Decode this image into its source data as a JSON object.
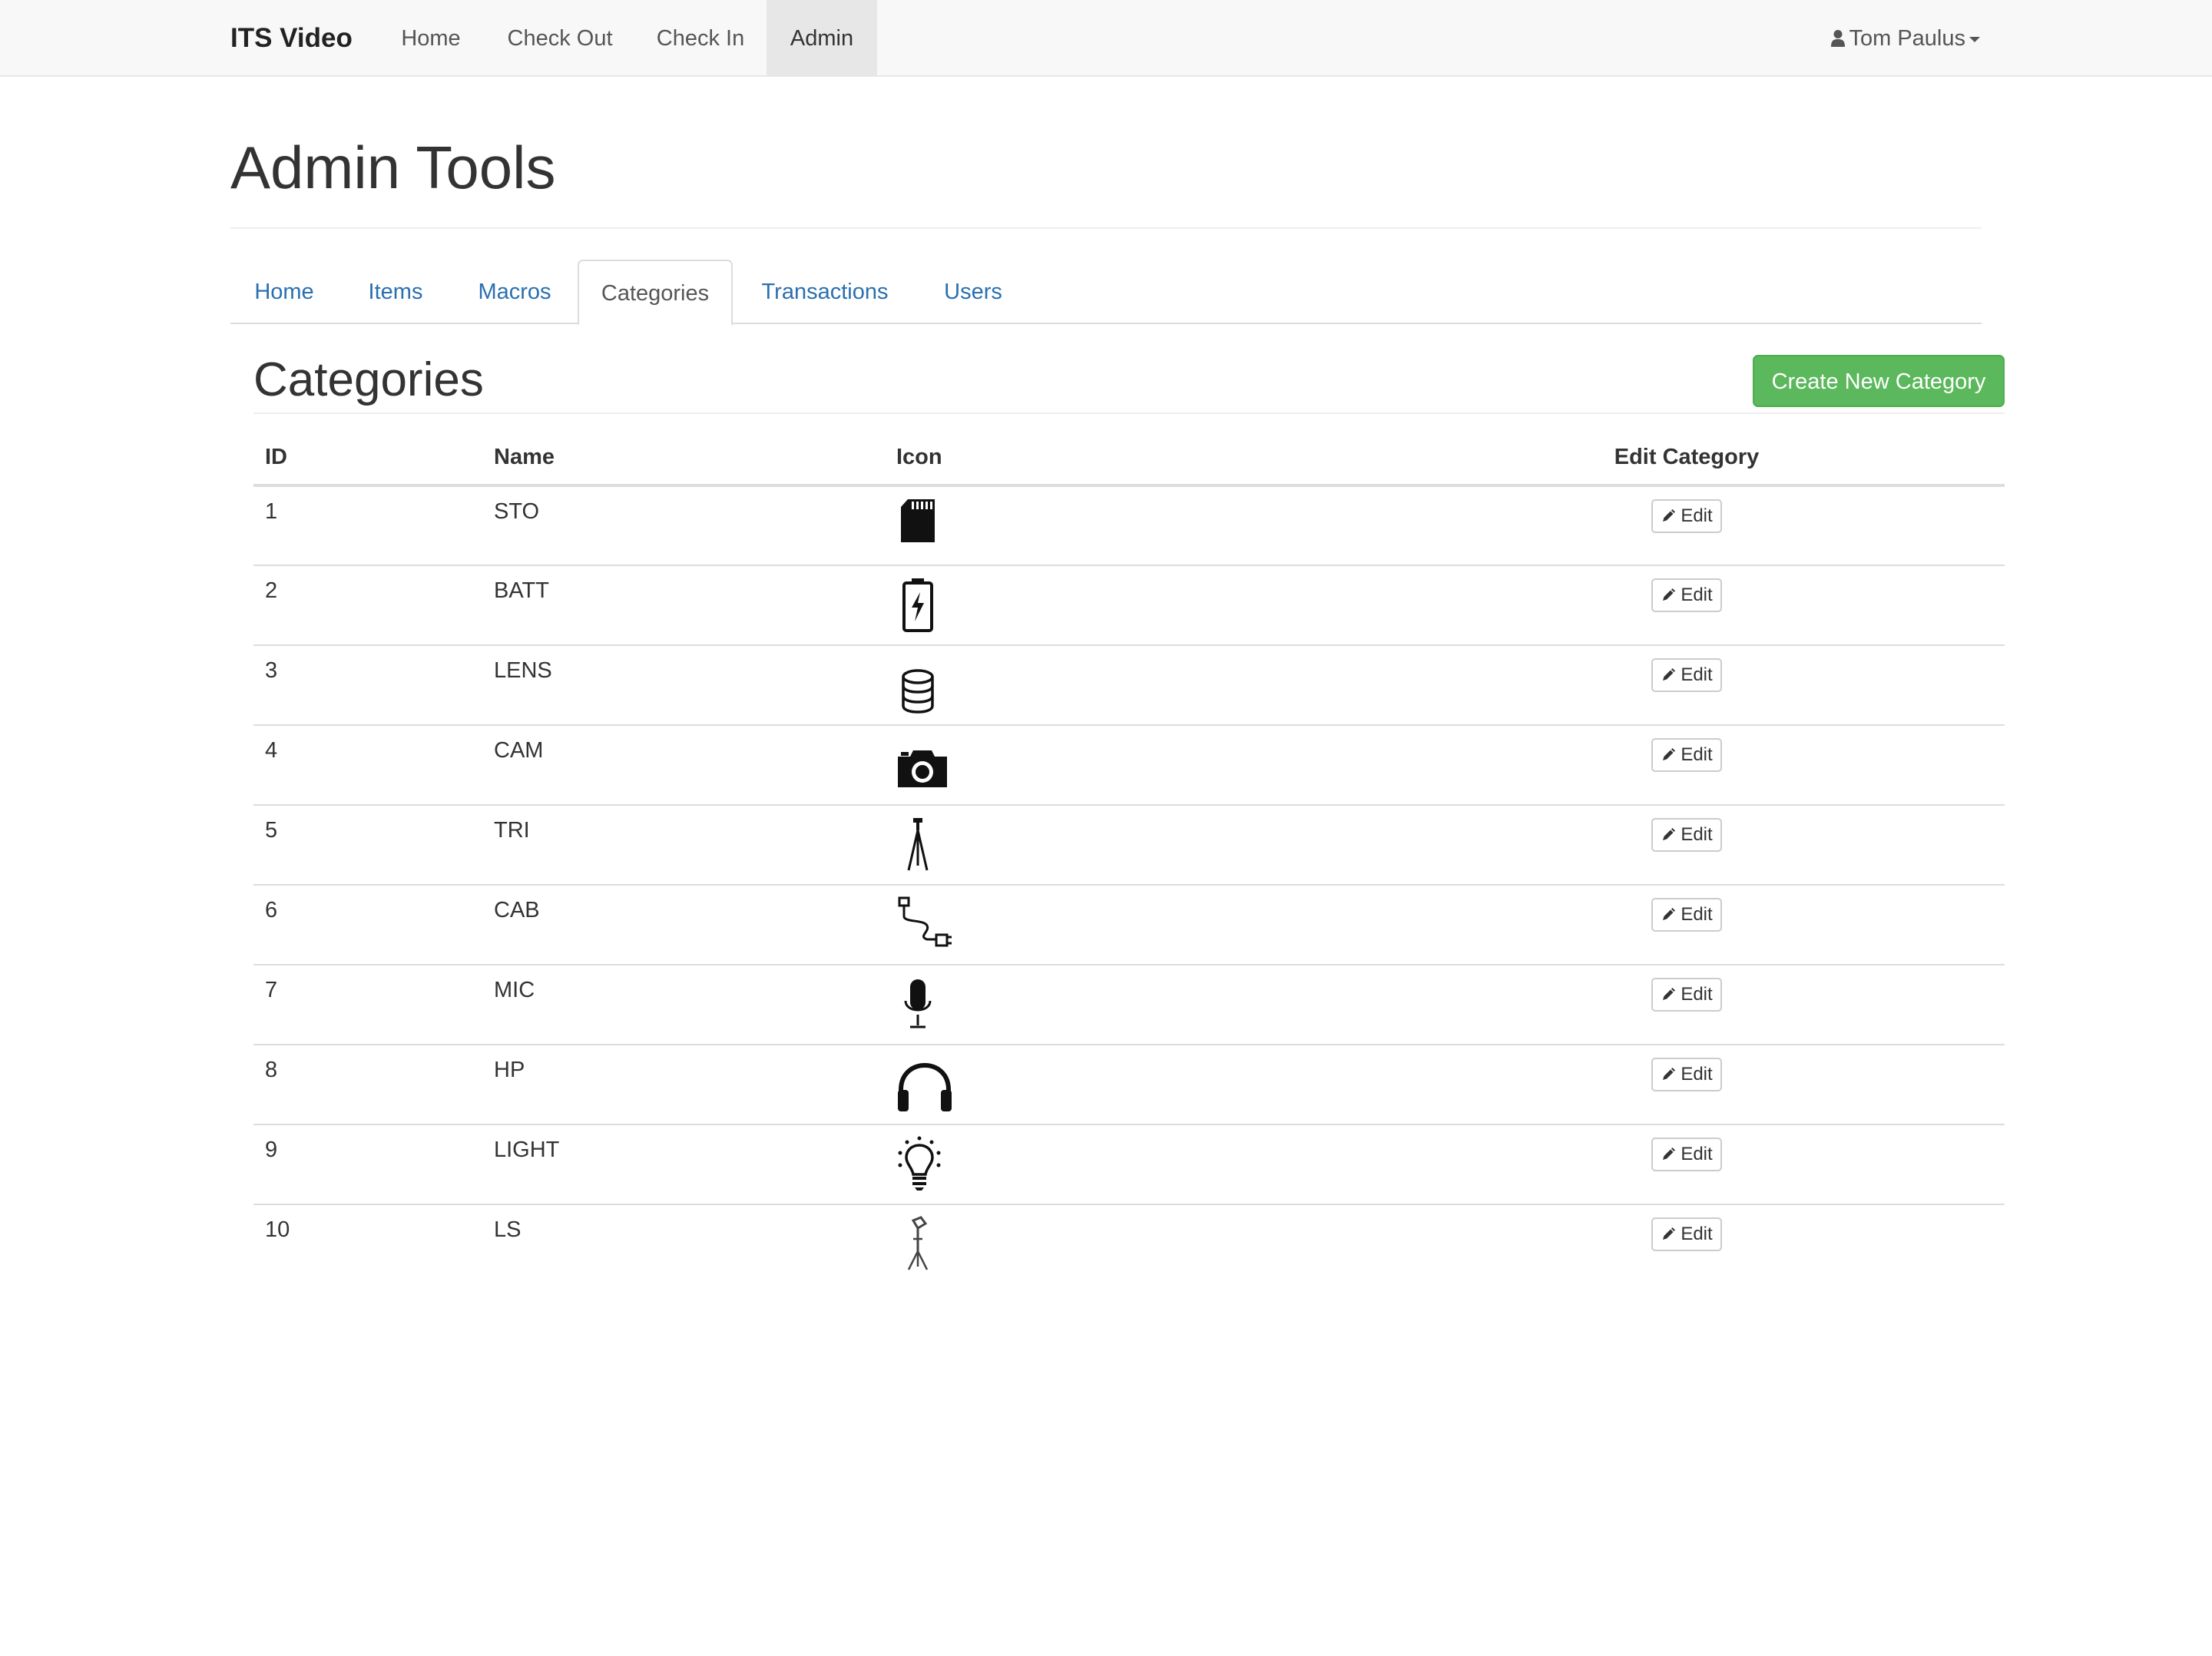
{
  "navbar": {
    "brand": "ITS Video",
    "links": [
      {
        "label": "Home",
        "active": false
      },
      {
        "label": "Check Out",
        "active": false
      },
      {
        "label": "Check In",
        "active": false
      },
      {
        "label": "Admin",
        "active": true
      }
    ],
    "user": {
      "name": "Tom Paulus",
      "icon": "user-icon"
    }
  },
  "page": {
    "title": "Admin Tools"
  },
  "tabs": [
    {
      "label": "Home",
      "active": false
    },
    {
      "label": "Items",
      "active": false
    },
    {
      "label": "Macros",
      "active": false
    },
    {
      "label": "Categories",
      "active": true
    },
    {
      "label": "Transactions",
      "active": false
    },
    {
      "label": "Users",
      "active": false
    }
  ],
  "section": {
    "title": "Categories",
    "create_button": "Create New Category"
  },
  "table": {
    "headers": {
      "id": "ID",
      "name": "Name",
      "icon": "Icon",
      "edit": "Edit Category"
    },
    "edit_label": "Edit",
    "rows": [
      {
        "id": "1",
        "name": "STO",
        "icon": "sd-card-icon"
      },
      {
        "id": "2",
        "name": "BATT",
        "icon": "battery-icon"
      },
      {
        "id": "3",
        "name": "LENS",
        "icon": "lens-icon"
      },
      {
        "id": "4",
        "name": "CAM",
        "icon": "camera-icon"
      },
      {
        "id": "5",
        "name": "TRI",
        "icon": "tripod-icon"
      },
      {
        "id": "6",
        "name": "CAB",
        "icon": "cable-icon"
      },
      {
        "id": "7",
        "name": "MIC",
        "icon": "microphone-icon"
      },
      {
        "id": "8",
        "name": "HP",
        "icon": "headphones-icon"
      },
      {
        "id": "9",
        "name": "LIGHT",
        "icon": "lightbulb-icon"
      },
      {
        "id": "10",
        "name": "LS",
        "icon": "light-stand-icon"
      }
    ]
  },
  "colors": {
    "navbar_bg": "#f8f8f8",
    "active_nav_bg": "#e7e7e7",
    "link": "#2a6fb0",
    "success_button": "#5cb85c"
  }
}
